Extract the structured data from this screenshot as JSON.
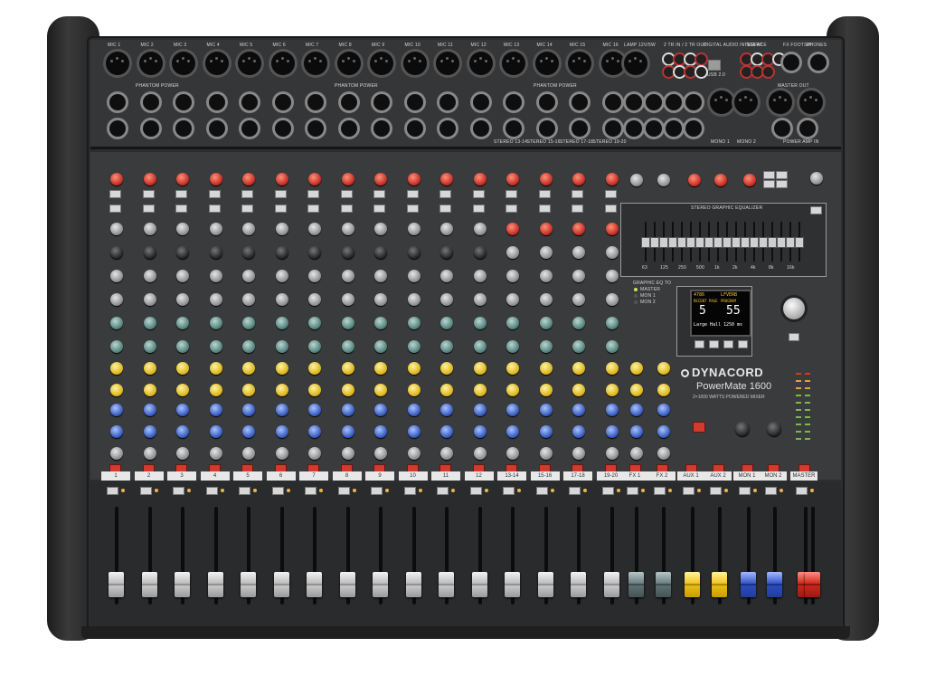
{
  "device": {
    "brand": "DYNACORD",
    "model": "PowerMate 1600",
    "subtitle": "2×1000 WATTS POWERED MIXER"
  },
  "inputs": {
    "mic_labels": [
      "MIC 1",
      "MIC 2",
      "MIC 3",
      "MIC 4",
      "MIC 5",
      "MIC 6",
      "MIC 7",
      "MIC 8",
      "MIC 9",
      "MIC 10",
      "MIC 11",
      "MIC 12",
      "MIC 13",
      "MIC 14",
      "MIC 15",
      "MIC 16"
    ],
    "phantom_labels": [
      "PHANTOM POWER",
      "PHANTOM POWER",
      "PHANTOM POWER"
    ],
    "stereo_input_labels": [
      "STEREO 13-14",
      "STEREO 15-16",
      "STEREO 17-18",
      "STEREO 19-20"
    ],
    "right_labels": {
      "usb": "DIGITAL AUDIO INTERFACE",
      "usb_port": "USB 2.0",
      "lamp": "LAMP 12V/5W",
      "tape": "2 TR IN / 2 TR OUT",
      "insert": "INSERT",
      "phones": "PHONES",
      "footswitch": "FX FOOTSW",
      "mono_out": "MONO 1",
      "mono_out2": "MONO 2",
      "master_outs": "MASTER OUT",
      "power_amp": "POWER AMP IN"
    }
  },
  "strip": {
    "channel_labels": [
      "1",
      "2",
      "3",
      "4",
      "5",
      "6",
      "7",
      "8",
      "9",
      "10",
      "11",
      "12",
      "13-14",
      "15-16",
      "17-18",
      "19-20"
    ],
    "return_labels": [
      "FX 1",
      "FX 2",
      "AUX 1",
      "AUX 2",
      "MON 1",
      "MON 2",
      "MASTER"
    ]
  },
  "fx": {
    "display_line1_left": "4786",
    "display_line1_right": "LFVERB",
    "display_line2_left": "RECENT PAGE",
    "display_line2_right": "PROGRAM",
    "display_value_left": "5",
    "display_value_right": "55",
    "display_name": "Large Hall 1",
    "display_time": "250 ms",
    "master_select_title": "GRAPHIC EQ TO",
    "master_select_options": [
      "MASTER",
      "MON 1",
      "MON 2"
    ]
  },
  "eq_label": "STEREO GRAPHIC EQUALIZER",
  "eq_bands": [
    "63",
    "125",
    "250",
    "500",
    "1k",
    "2k",
    "4k",
    "8k",
    "16k"
  ],
  "colors": {
    "accent_red": "#d23a2e",
    "yellow": "#e5bd18",
    "blue": "#2f55b9",
    "teal": "#4e7d77"
  }
}
